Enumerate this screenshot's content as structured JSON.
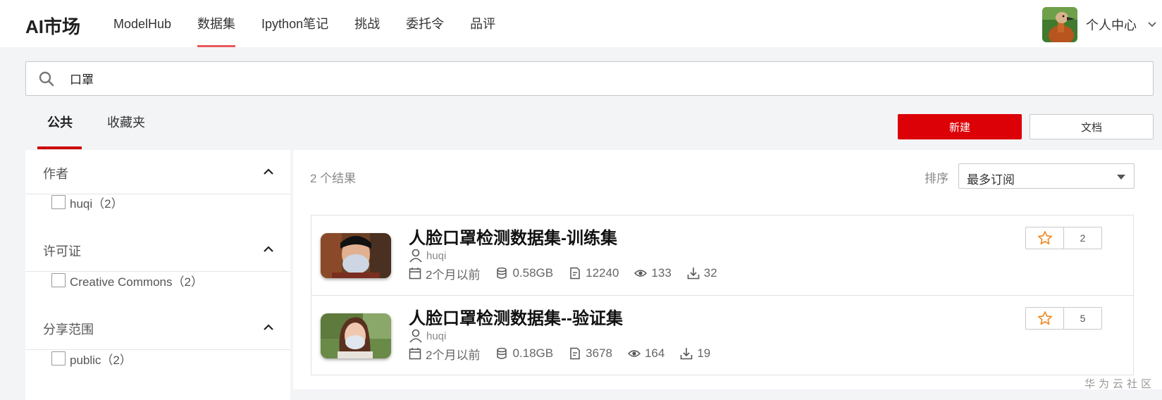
{
  "app": {
    "logo": "AI市场"
  },
  "nav": {
    "items": [
      "ModelHub",
      "数据集",
      "Ipython笔记",
      "挑战",
      "委托令",
      "品评"
    ],
    "active_index": 1
  },
  "user": {
    "label": "个人中心"
  },
  "search": {
    "value": "口罩"
  },
  "tabs": {
    "public": "公共",
    "favorites": "收藏夹"
  },
  "buttons": {
    "new": "新建",
    "docs": "文档"
  },
  "filters": {
    "author": {
      "title": "作者",
      "option": "huqi（2）"
    },
    "license": {
      "title": "许可证",
      "option": "Creative Commons（2）"
    },
    "scope": {
      "title": "分享范围",
      "option": "public（2）"
    }
  },
  "results": {
    "count_text": "2 个结果",
    "sort_label": "排序",
    "sort_value": "最多订阅",
    "items": [
      {
        "title": "人脸口罩检测数据集-训练集",
        "author": "huqi",
        "time": "2个月以前",
        "size": "0.58GB",
        "files": "12240",
        "views": "133",
        "downloads": "32",
        "stars": "2"
      },
      {
        "title": "人脸口罩检测数据集--验证集",
        "author": "huqi",
        "time": "2个月以前",
        "size": "0.18GB",
        "files": "3678",
        "views": "164",
        "downloads": "19",
        "stars": "5"
      }
    ]
  },
  "watermark": "华为云社区",
  "colors": {
    "primary": "#dc0007",
    "nav_underline": "#e8585d",
    "star": "#f08a24"
  }
}
